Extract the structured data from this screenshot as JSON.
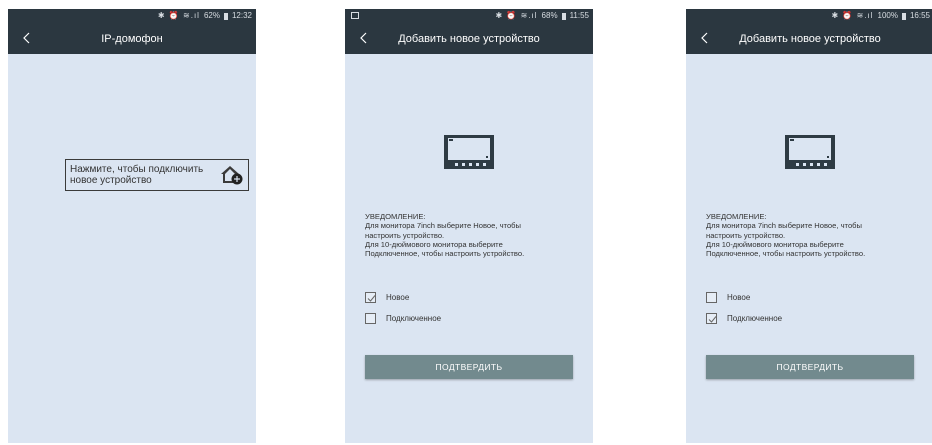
{
  "colors": {
    "bar": "#2b3740",
    "screen_bg": "#dbe5f2",
    "button": "#728a8e"
  },
  "screen1": {
    "status": {
      "icons": "✱ ⏰ ≋.ıl",
      "battery": "62%",
      "time": "12:32"
    },
    "title": "IP-домофон",
    "back_icon": "chevron-left-icon",
    "connect_line1": "Нажмите, чтобы подключить",
    "connect_line2": "новое устройство",
    "connect_icon": "home-add-icon"
  },
  "screen2": {
    "status": {
      "icons": "✱ ⏰ ≋.ıl",
      "battery": "68%",
      "time": "11:55"
    },
    "title": "Добавить новое устройство",
    "notice": [
      "УВЕДОМЛЕНИЕ:",
      "Для монитора 7inch выберите Новое, чтобы",
      "настроить устройство.",
      "Для 10-дюймового монитора выберите",
      "Подключенное, чтобы настроить устройство."
    ],
    "options": [
      {
        "label": "Новое",
        "checked": true
      },
      {
        "label": "Подключенное",
        "checked": false
      }
    ],
    "confirm": "ПОДТВЕРДИТЬ"
  },
  "screen3": {
    "status": {
      "icons": "✱ ⏰ ≋.ıl",
      "battery": "100%",
      "time": "16:55"
    },
    "title": "Добавить новое устройство",
    "notice": [
      "УВЕДОМЛЕНИЕ:",
      "Для монитора 7inch выберите Новое, чтобы",
      "настроить устройство.",
      "Для 10-дюймового монитора выберите",
      "Подключенное, чтобы настроить устройство."
    ],
    "options": [
      {
        "label": "Новое",
        "checked": false
      },
      {
        "label": "Подключенное",
        "checked": true
      }
    ],
    "confirm": "ПОДТВЕРДИТЬ"
  }
}
